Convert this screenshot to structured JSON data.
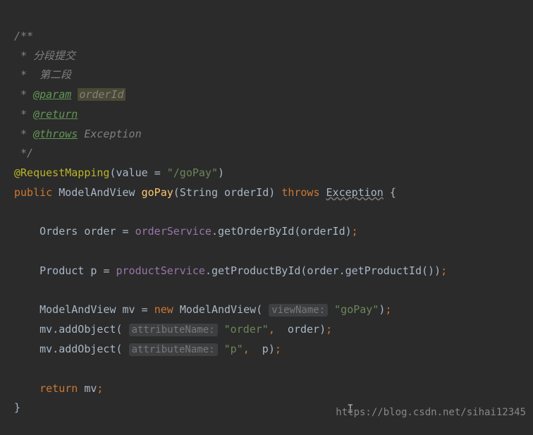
{
  "code": {
    "line1": "/**",
    "line2_prefix": " * ",
    "line2_text": "分段提交",
    "line3_prefix": " *  ",
    "line3_text": "第二段",
    "line4_prefix": " * ",
    "line4_tag": "@param",
    "line4_param": "orderId",
    "line5_prefix": " * ",
    "line5_tag": "@return",
    "line6_prefix": " * ",
    "line6_tag": "@throws",
    "line6_exception": " Exception",
    "line7": " */",
    "line8_annotation": "@RequestMapping",
    "line8_paren_open": "(",
    "line8_value": "value ",
    "line8_equals": "= ",
    "line8_string": "\"/goPay\"",
    "line8_paren_close": ")",
    "line9_public": "public ",
    "line9_type": "ModelAndView ",
    "line9_method": "goPay",
    "line9_params_open": "(",
    "line9_param_type": "String ",
    "line9_param_name": "orderId",
    "line9_params_close": ") ",
    "line9_throws": "throws ",
    "line9_exception": "Exception",
    "line9_brace": " {",
    "line11_indent": "    ",
    "line11_type": "Orders ",
    "line11_var": "order ",
    "line11_equals": "= ",
    "line11_service": "orderService",
    "line11_dot": ".",
    "line11_method": "getOrderById",
    "line11_call": "(orderId)",
    "line11_semi": ";",
    "line13_indent": "    ",
    "line13_type": "Product ",
    "line13_var": "p ",
    "line13_equals": "= ",
    "line13_service": "productService",
    "line13_dot": ".",
    "line13_method": "getProductById",
    "line13_call_open": "(",
    "line13_order": "order",
    "line13_dot2": ".",
    "line13_getpid": "getProductId",
    "line13_call_close": "())",
    "line13_semi": ";",
    "line15_indent": "    ",
    "line15_type": "ModelAndView ",
    "line15_var": "mv ",
    "line15_equals": "= ",
    "line15_new": "new ",
    "line15_class": "ModelAndView",
    "line15_paren_open": "( ",
    "line15_hint": "viewName:",
    "line15_space": " ",
    "line15_string": "\"goPay\"",
    "line15_paren_close": ")",
    "line15_semi": ";",
    "line16_indent": "    ",
    "line16_mv": "mv",
    "line16_dot": ".",
    "line16_method": "addObject",
    "line16_paren_open": "( ",
    "line16_hint": "attributeName:",
    "line16_space": " ",
    "line16_string": "\"order\"",
    "line16_comma": ",  ",
    "line16_arg": "order",
    "line16_paren_close": ")",
    "line16_semi": ";",
    "line17_indent": "    ",
    "line17_mv": "mv",
    "line17_dot": ".",
    "line17_method": "addObject",
    "line17_paren_open": "( ",
    "line17_hint": "attributeName:",
    "line17_space": " ",
    "line17_string": "\"p\"",
    "line17_comma": ",  ",
    "line17_arg": "p",
    "line17_paren_close": ")",
    "line17_semi": ";",
    "line19_indent": "    ",
    "line19_return": "return ",
    "line19_var": "mv",
    "line19_semi": ";",
    "line20": "}"
  },
  "watermark": "https://blog.csdn.net/sihai12345"
}
